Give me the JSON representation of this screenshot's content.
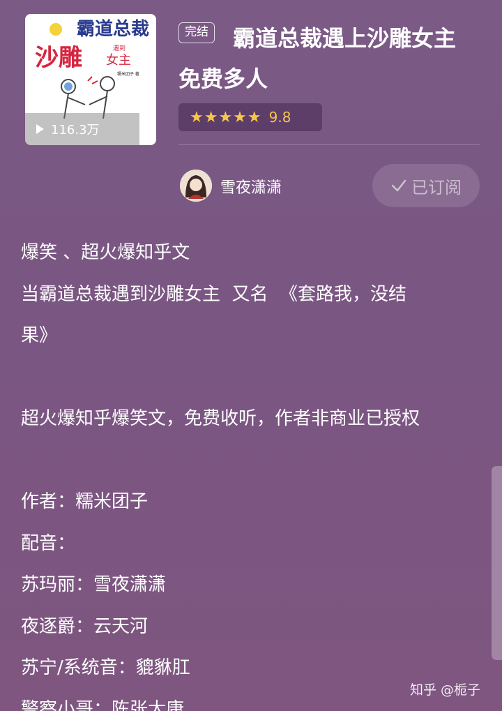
{
  "book": {
    "status": "完结",
    "title": "霸道总裁遇上沙雕女主 免费多人",
    "stars": "★★★★★",
    "rating": "9.8",
    "play_count": "116.3万"
  },
  "cover": {
    "title_line1": "霸道总裁",
    "title_line2": "沙雕",
    "title_line3": "女主",
    "small_text": "遇到",
    "author_mark": "糯米团子 著"
  },
  "author": {
    "name": "雪夜潇潇"
  },
  "subscribe": {
    "label": "已订阅"
  },
  "description": {
    "lines": [
      "爆笑 、超火爆知乎文",
      "当霸道总裁遇到沙雕女主  又名  《套路我，没结",
      "果》",
      "",
      "超火爆知乎爆笑文，免费收听，作者非商业已授权",
      "",
      "作者：糯米团子",
      "配音：",
      "苏玛丽：雪夜潇潇",
      "夜逐爵：云天河",
      "苏宁/系统音：貔貅肛",
      "警察小哥：陈张太康"
    ]
  },
  "watermark": "知乎 @栀子",
  "colors": {
    "background": "#7a5682",
    "star": "#f7c64e"
  }
}
